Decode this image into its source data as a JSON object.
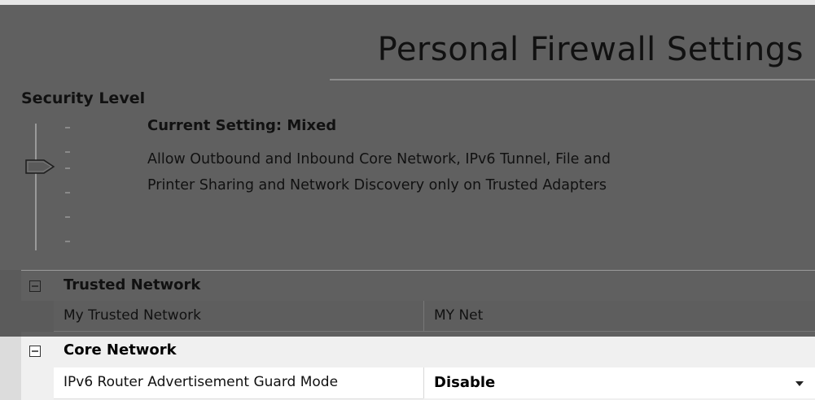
{
  "header": {
    "title": "Personal Firewall Settings"
  },
  "security": {
    "label": "Security Level",
    "current_setting": "Current Setting: Mixed",
    "description_line1": "Allow Outbound and Inbound Core Network, IPv6 Tunnel, File and",
    "description_line2": "Printer Sharing and Network Discovery only on Trusted Adapters",
    "slider_levels": 6,
    "slider_selected_index": 2
  },
  "grid": {
    "categories": [
      {
        "label": "Trusted Network",
        "expander": "minus",
        "properties": [
          {
            "name": "My Trusted Network",
            "value": "MY Net"
          }
        ]
      },
      {
        "label": "Core Network",
        "expander": "minus",
        "properties": [
          {
            "name": "IPv6 Router Advertisement Guard Mode",
            "value": "Disable"
          }
        ]
      }
    ]
  },
  "icons": {
    "expander": "collapse-minus-icon",
    "dropdown": "chevron-down-icon",
    "slider_thumb": "slider-thumb-icon"
  },
  "colors": {
    "overlay_dim": "#606060",
    "lit_background": "#f0f0f0",
    "cell_background": "#ffffff"
  }
}
